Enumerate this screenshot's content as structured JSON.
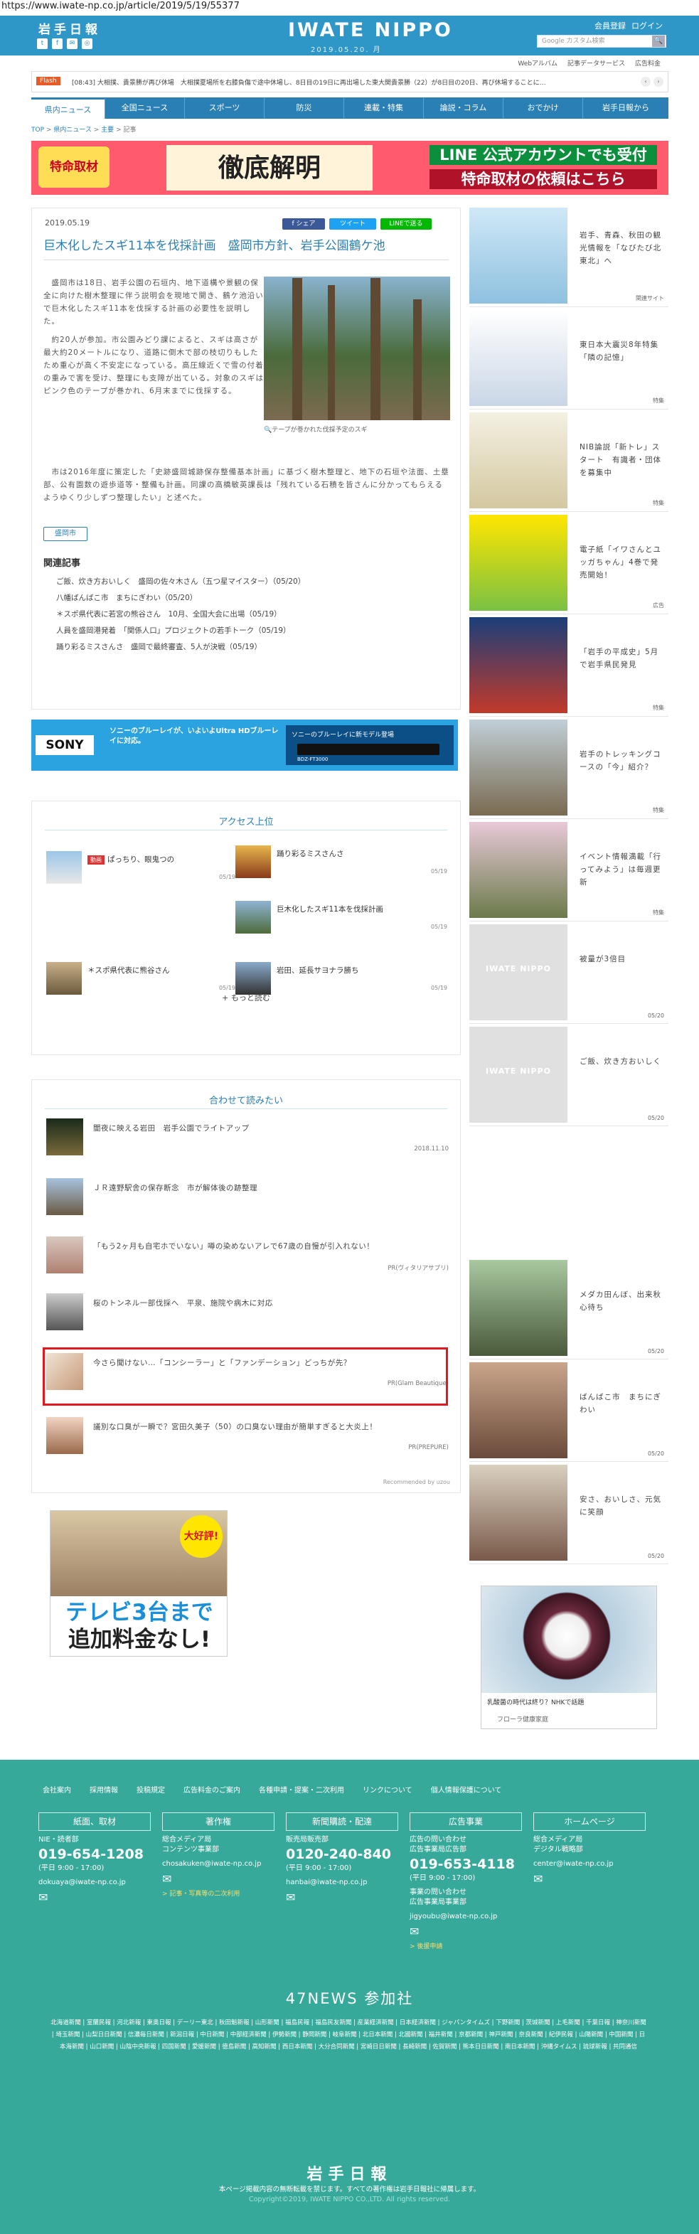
{
  "url": "https://www.iwate-np.co.jp/article/2019/5/19/55377",
  "header": {
    "logo": "岩手日報",
    "brand": "IWATE NIPPO",
    "date": "2019.05.20. 月",
    "links": [
      "会員登録",
      "ログイン"
    ],
    "search_placeholder": "Google カスタム検索",
    "search_btn": "🔍"
  },
  "subnav": [
    "Webアルバム",
    "記事データサービス",
    "広告料金"
  ],
  "flash": {
    "tag": "Flash",
    "text": "[08:43] 大相撲、貴景勝が再び休場　大相撲夏場所を右膝負傷で途中休場し、8日目の19日に再出場した東大関貴景勝（22）が8日目の20日、再び休場することに…"
  },
  "nav": [
    "県内ニュース",
    "全国ニュース",
    "スポーツ",
    "防災",
    "連載・特集",
    "論説・コラム",
    "おでかけ",
    "岩手日報から"
  ],
  "breadcrumb": {
    "top": "TOP",
    "sep": ">",
    "p1": "県内ニュース",
    "p2": "主要",
    "p3": "記事"
  },
  "banner": {
    "left": "特命取材",
    "mid": "徹底解明",
    "r1": "LINE 公式アカウントでも受付",
    "r2": "特命取材の依頼はこちら"
  },
  "article": {
    "date": "2019.05.19",
    "share": [
      "f シェア",
      "ツイート",
      "LINEで送る"
    ],
    "title": "巨木化したスギ11本を伐採計画　盛岡市方針、岩手公園鶴ケ池",
    "p1": "　盛岡市は18日、岩手公園の石垣内、地下道構や景観の保全に向けた樹木整理に伴う説明会を現地で開き、鶴ケ池沿いで巨木化したスギ11本を伐採する計画の必要性を説明した。",
    "p2": "　約20人が参加。市公園みどり課によると、スギは高さが最大約20メートルになり、道路に倒木で部の枝切りもしたため重心が高く不安定になっている。高圧線近くで雪の付着の重みで害を受け、整理にも支障が出ている。対象のスギはピンク色のテープが巻かれ、6月末までに伐採する。",
    "caption": "🔍テープが巻かれた伐採予定のスギ",
    "p3": "　市は2016年度に策定した「史跡盛岡城跡保存整備基本計画」に基づく樹木整理と、地下の石垣や法面、土塁部、公有園数の遊歩道等・整備も計画。同課の高橋敏英課長は「残れている石積を皆さんに分かってもらえるようゆくり少しずつ整理したい」と述べた。",
    "tag": "盛岡市",
    "related_title": "関連記事",
    "related": [
      "ご飯、炊き方おいしく　盛岡の佐々木さん（五つ星マイスター）（05/20）",
      "八幡ばんばこ市　まちにぎわい（05/20）",
      "＊スポ県代表に若宮の熊谷さん　10月、全国大会に出場（05/19）",
      "人員を盛岡港発着　「関係人口」プロジェクトの若手トーク（05/19）",
      "踊り彩るミスさんさ　盛岡で最終審査、5人が決戦（05/19）"
    ]
  },
  "sony_ad": {
    "logo": "SONY",
    "text": "ソニーのブルーレイが、いよいよUltra HDブルーレイに対応。",
    "rec_title": "ソニーのブルーレイに新モデル登場",
    "model": "BDZ-FT3000"
  },
  "ranking": {
    "title": "アクセス上位",
    "items": [
      {
        "title": "ぱっちり、眼鬼つの",
        "date": "05/19",
        "badge": "動画"
      },
      {
        "title": "踊り彩るミスさんさ",
        "date": "05/19"
      },
      {
        "title": "巨木化したスギ11本を伐採計画",
        "date": "05/19"
      },
      {
        "title": "＊スポ県代表に熊谷さん",
        "date": "05/19"
      },
      {
        "title": "岩田、延長サヨナラ勝ち",
        "date": "05/19"
      }
    ],
    "more": "+ もっと読む"
  },
  "readalso": {
    "title": "合わせて読みたい",
    "items": [
      {
        "title": "闇夜に映える岩田　岩手公園でライトアップ",
        "date": "2018.11.10"
      },
      {
        "title": "ＪＲ遠野駅舎の保存断念　市が解体後の跡整理",
        "date": ""
      },
      {
        "title": "「もう2ヶ月も自宅ホでいない」噂の染めないアレで67歳の自慢が引入れない！",
        "date": "PR(ヴィタリアサプリ)"
      },
      {
        "title": "桜のトンネル一部伐採へ　平泉、施院や病木に対応",
        "date": ""
      },
      {
        "title": "今さら聞けない…「コンシーラー」と「ファンデーション」どっちが先？",
        "date": "PR(Glam Beautique)"
      },
      {
        "title": "議別な口臭が一瞬で？宮田久美子（50）の口臭ない理由が簡単すぎると大炎上！",
        "date": "PR(PREPURE)"
      }
    ],
    "powered": "Recommended by uzou"
  },
  "tv_ad": {
    "sticker": "大好評!",
    "big1": "テレビ3台まで",
    "big2": "追加料金なし!"
  },
  "sidebar": [
    {
      "title": "岩手、青森、秋田の観光情報を「なびたび北東北」へ",
      "tag": "関連サイト"
    },
    {
      "title": "東日本大震災8年特集「隣の記憶」",
      "tag": "特集"
    },
    {
      "title": "NIB論説「新トレ」スタート　有識者・団体を募集中",
      "tag": "特集"
    },
    {
      "title": "電子紙「イワさんとユッガちゃん」4巻で発売開始！",
      "tag": "広告"
    },
    {
      "title": "「岩手の平成史」5月で岩手県民発見",
      "tag": "特集"
    },
    {
      "title": "岩手のトレッキングコースの「今」紹介？",
      "tag": "特集"
    },
    {
      "title": "イベント情報満載「行ってみよう」は毎週更新",
      "tag": "特集"
    },
    {
      "title": "被量が3倍目",
      "tag": "05/20"
    },
    {
      "title": "ご飯、炊き方おいしく",
      "tag": "05/20"
    },
    {
      "title": "メダカ田んぼ、出来秋心待ち",
      "tag": "05/20"
    },
    {
      "title": "ばんばこ市　まちにぎわい",
      "tag": "05/20"
    },
    {
      "title": "安さ、おいしさ、元気に笑顔",
      "tag": "05/20"
    }
  ],
  "yogurt_ad": {
    "text": "乳酸菌の時代は終り？NHKで話題",
    "sponsor": "フローラ健康家庭"
  },
  "footer": {
    "links": [
      "会社案内",
      "採用情報",
      "投稿規定",
      "広告料金のご案内",
      "各種申請・提案・二次利用",
      "リンクについて",
      "個人情報保護について"
    ],
    "cols": [
      {
        "head": "紙面、取材",
        "l1": "NIE・読者部",
        "phone": "019-654-1208",
        "hours": "(平日 9:00 - 17:00)",
        "mail": "dokuaya@iwate-np.co.jp",
        "link": ""
      },
      {
        "head": "著作権",
        "l1": "総合メディア局",
        "l2": "コンテンツ事業部",
        "mail": "chosakuken@iwate-np.co.jp",
        "link": "> 記事・写真等の二次利用"
      },
      {
        "head": "新聞購読・配達",
        "l1": "販売局販売部",
        "phone": "0120-240-840",
        "hours": "(平日 9:00 - 17:00)",
        "mail": "hanbai@iwate-np.co.jp",
        "link": ""
      },
      {
        "head": "広告事業",
        "l1": "広告の問い合わせ",
        "l2": "広告事業局広告部",
        "phone": "019-653-4118",
        "hours": "(平日 9:00 - 17:00)",
        "l3": "事業の問い合わせ",
        "l4": "広告事業局事業部",
        "mail": "jigyoubu@iwate-np.co.jp",
        "link": "> 後援申請"
      },
      {
        "head": "ホームページ",
        "l1": "総合メディア局",
        "l2": "デジタル戦略部",
        "mail": "center@iwate-np.co.jp",
        "link": ""
      }
    ],
    "network": "47NEWS 参加社",
    "sites": "北海道新聞 | 室蘭民報 | 河北新報 | 東奥日報 | デーリー東北 | 秋田魁新報 | 山形新聞 | 福島民報 | 福島民友新聞 | 産業経済新聞 | 日本経済新聞 | ジャパンタイムズ | 下野新聞 | 茨城新聞 | 上毛新聞 | 千葉日報 | 神奈川新聞 | 埼玉新聞 | 山梨日日新聞 | 信濃毎日新聞 | 新潟日報 | 中日新聞 | 中部経済新聞 | 伊勢新聞 | 静岡新聞 | 岐阜新聞 | 北日本新聞 | 北國新聞 | 福井新聞 | 京都新聞 | 神戸新聞 | 奈良新聞 | 紀伊民報 | 山陽新聞 | 中国新聞 | 日本海新聞 | 山口新聞 | 山陰中央新報 | 四国新聞 | 愛媛新聞 | 徳島新聞 | 高知新聞 | 西日本新聞 | 大分合同新聞 | 宮崎日日新聞 | 長崎新聞 | 佐賀新聞 | 熊本日日新聞 | 南日本新聞 | 沖縄タイムス | 琉球新報 | 共同通信",
    "logo": "岩手日報",
    "copy1": "本ページ掲載内容の無断転載を禁じます。すべての著作権は岩手日報社に帰属します。",
    "copy2": "Copyright©2019, IWATE NIPPO CO.,LTD. All rights reserved."
  }
}
